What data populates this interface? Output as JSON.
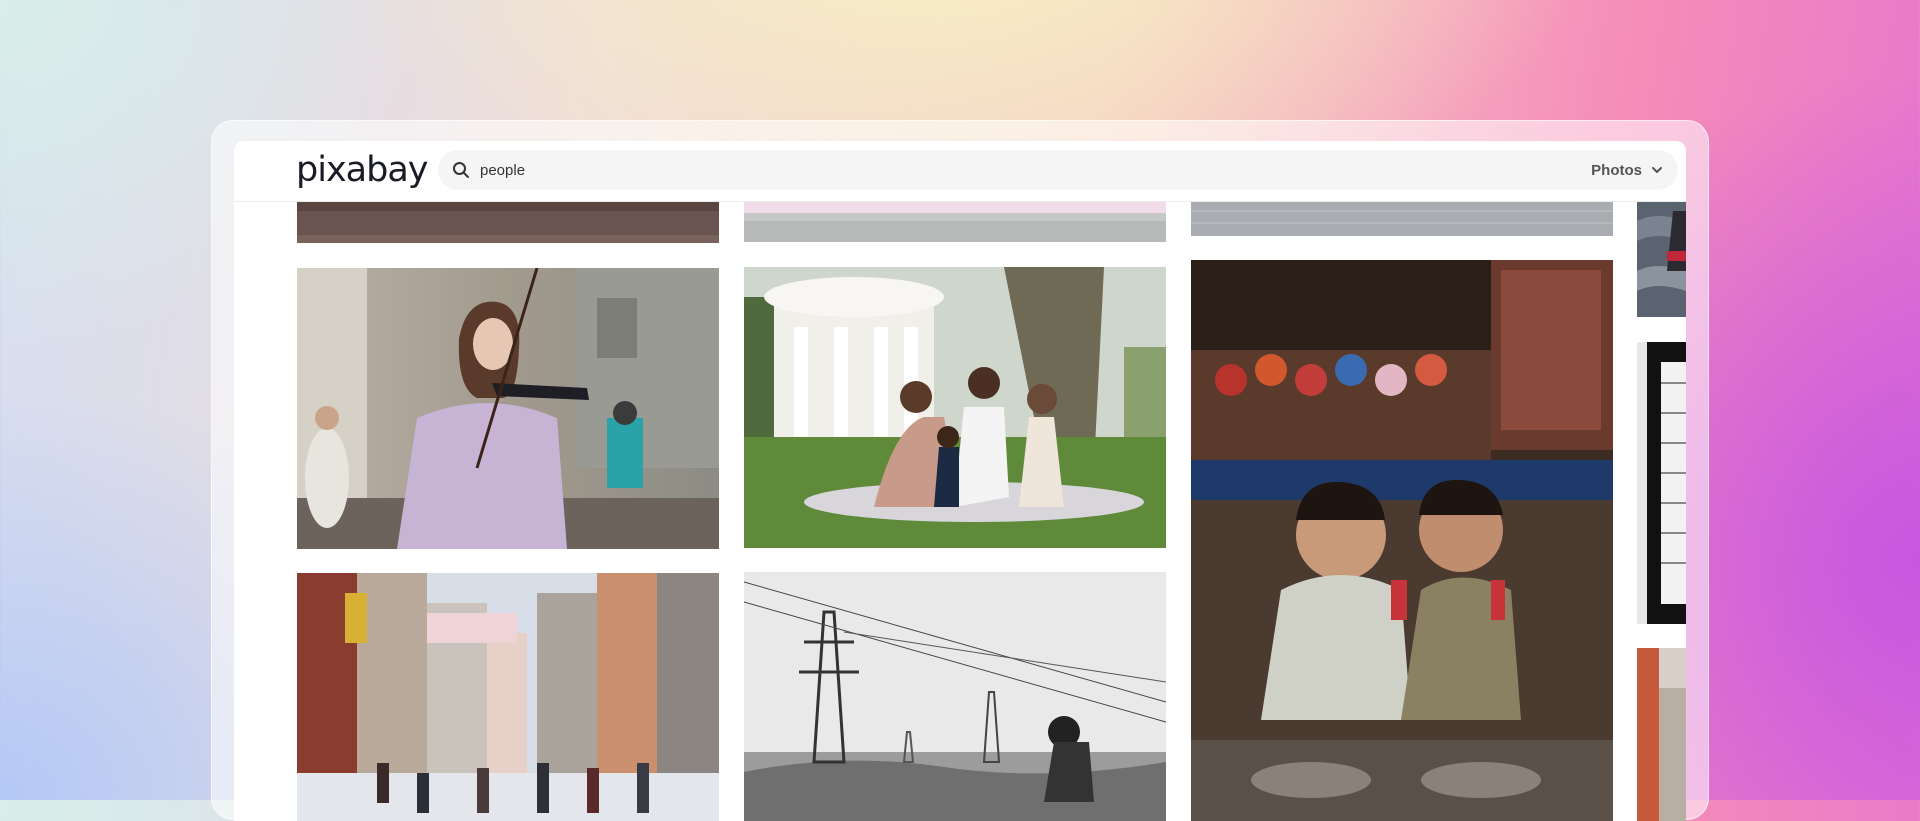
{
  "brand": {
    "logo_text": "pixabay"
  },
  "search": {
    "value": "people",
    "placeholder": ""
  },
  "type_filter": {
    "selected": "Photos"
  },
  "icons": {
    "search": "search-icon",
    "dropdown": "chevron-down-icon"
  },
  "colors": {
    "logo": "#191b26",
    "search_bg": "#f5f5f5",
    "filter_text": "#555555"
  }
}
